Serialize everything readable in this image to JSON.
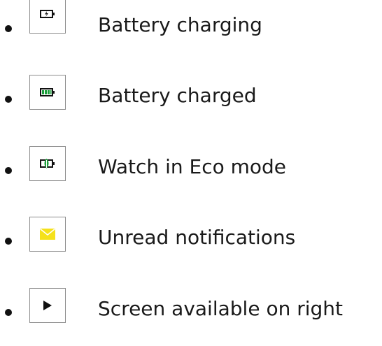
{
  "status_icons": [
    {
      "icon": "battery-charging-icon",
      "label": "Battery charging"
    },
    {
      "icon": "battery-charged-icon",
      "label": "Battery charged",
      "accent": "#1a9e3a"
    },
    {
      "icon": "eco-mode-icon",
      "label": "Watch in Eco mode",
      "accent": "#1a9e3a"
    },
    {
      "icon": "unread-notifications-icon",
      "label": "Unread notifications",
      "accent": "#f5e11b"
    },
    {
      "icon": "screen-available-right-icon",
      "label": "Screen available on right"
    }
  ]
}
